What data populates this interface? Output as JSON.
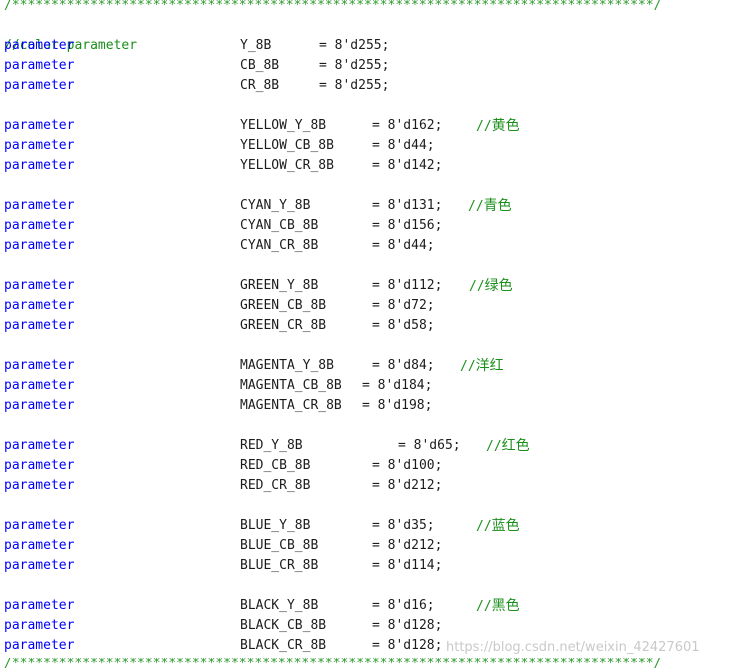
{
  "editor": {
    "border_top": "/**********************************************************************************/",
    "border_bottom": "/**********************************************************************************/",
    "section_comment": "//color parameter",
    "keyword": "parameter",
    "lines": [
      {
        "name": "Y_8B",
        "value": "= 8'd255;",
        "comment": ""
      },
      {
        "name": "CB_8B",
        "value": "= 8'd255;",
        "comment": ""
      },
      {
        "name": "CR_8B",
        "value": "= 8'd255;",
        "comment": ""
      },
      {
        "name": "YELLOW_Y_8B",
        "value": "= 8'd162;",
        "comment": "//黄色"
      },
      {
        "name": "YELLOW_CB_8B",
        "value": "= 8'd44;",
        "comment": ""
      },
      {
        "name": "YELLOW_CR_8B",
        "value": "= 8'd142;",
        "comment": ""
      },
      {
        "name": "CYAN_Y_8B",
        "value": "= 8'd131;",
        "comment": "//青色"
      },
      {
        "name": "CYAN_CB_8B",
        "value": "= 8'd156;",
        "comment": ""
      },
      {
        "name": "CYAN_CR_8B",
        "value": "= 8'd44;",
        "comment": ""
      },
      {
        "name": "GREEN_Y_8B",
        "value": "= 8'd112;",
        "comment": "//绿色"
      },
      {
        "name": "GREEN_CB_8B",
        "value": "= 8'd72;",
        "comment": ""
      },
      {
        "name": "GREEN_CR_8B",
        "value": "= 8'd58;",
        "comment": ""
      },
      {
        "name": "MAGENTA_Y_8B",
        "value": "= 8'd84;",
        "comment": "//洋红"
      },
      {
        "name": "MAGENTA_CB_8B",
        "value": "= 8'd184;",
        "comment": ""
      },
      {
        "name": "MAGENTA_CR_8B",
        "value": "= 8'd198;",
        "comment": ""
      },
      {
        "name": "RED_Y_8B",
        "value": "= 8'd65;",
        "comment": "//红色"
      },
      {
        "name": "RED_CB_8B",
        "value": "= 8'd100;",
        "comment": ""
      },
      {
        "name": "RED_CR_8B",
        "value": "= 8'd212;",
        "comment": ""
      },
      {
        "name": "BLUE_Y_8B",
        "value": "= 8'd35;",
        "comment": "//蓝色"
      },
      {
        "name": "BLUE_CB_8B",
        "value": "= 8'd212;",
        "comment": ""
      },
      {
        "name": "BLUE_CR_8B",
        "value": "= 8'd114;",
        "comment": ""
      },
      {
        "name": "BLACK_Y_8B",
        "value": "= 8'd16;",
        "comment": "//黑色"
      },
      {
        "name": "BLACK_CB_8B",
        "value": "= 8'd128;",
        "comment": ""
      },
      {
        "name": "BLACK_CR_8B",
        "value": "= 8'd128;",
        "comment": ""
      }
    ]
  },
  "watermark": "https://blog.csdn.net/weixin_42427601",
  "colors": {
    "keyword": "#0000ff",
    "identifier": "#1c1c1c",
    "comment": "#1a8f1a",
    "watermark": "#c9c9c9"
  }
}
